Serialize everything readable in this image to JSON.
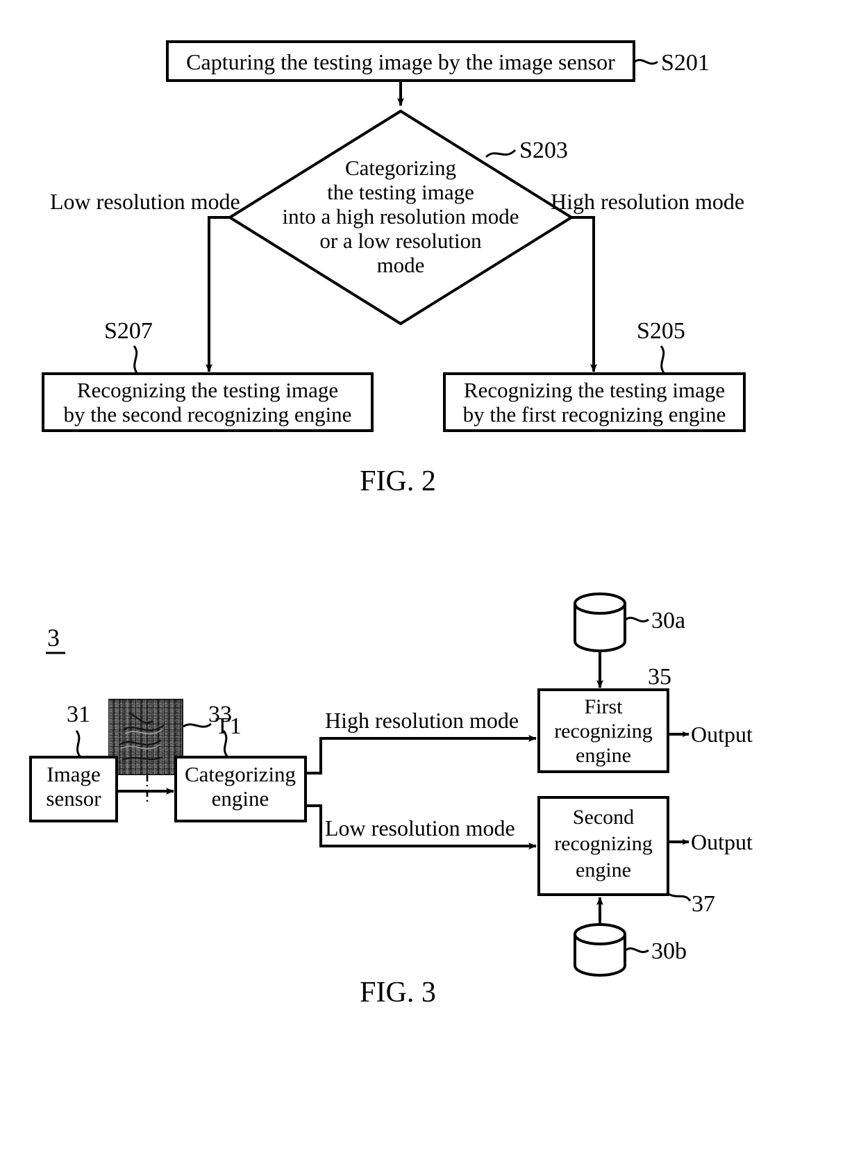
{
  "document": {
    "type": "patent-drawing-sheet",
    "figures": [
      "FIG. 2",
      "FIG. 3"
    ]
  },
  "fig2": {
    "caption": "FIG. 2",
    "step_start": {
      "ref": "S201",
      "text": "Capturing the testing image by the image sensor"
    },
    "decision": {
      "ref": "S203",
      "lines": [
        "Categorizing",
        "the testing image",
        "into a high resolution mode",
        "or a low resolution",
        "mode"
      ]
    },
    "branch_left_label": "Low resolution mode",
    "branch_right_label": "High resolution mode",
    "step_left": {
      "ref": "S207",
      "line1": "Recognizing the testing image",
      "line2": "by the second recognizing engine"
    },
    "step_right": {
      "ref": "S205",
      "line1": "Recognizing the testing image",
      "line2": "by the first recognizing engine"
    }
  },
  "fig3": {
    "caption": "FIG. 3",
    "system_ref": "3",
    "image_patch": {
      "ref": "T1",
      "description": "noisy-textured-testing-image"
    },
    "image_sensor": {
      "ref": "31",
      "line1": "Image",
      "line2": "sensor"
    },
    "categorizing_engine": {
      "ref": "33",
      "line1": "Categorizing",
      "line2": "engine"
    },
    "path_high_label": "High resolution mode",
    "path_low_label": "Low resolution mode",
    "first_engine": {
      "ref": "35",
      "line1": "First",
      "line2": "recognizing",
      "line3": "engine"
    },
    "second_engine": {
      "ref": "37",
      "line1": "Second",
      "line2": "recognizing",
      "line3": "engine"
    },
    "database_top": {
      "ref": "30a"
    },
    "database_bottom": {
      "ref": "30b"
    },
    "output_top": "Output",
    "output_bottom": "Output"
  },
  "colors": {
    "ink": "#000000",
    "paper": "#ffffff",
    "patch_fill": "#4a4a4a"
  }
}
